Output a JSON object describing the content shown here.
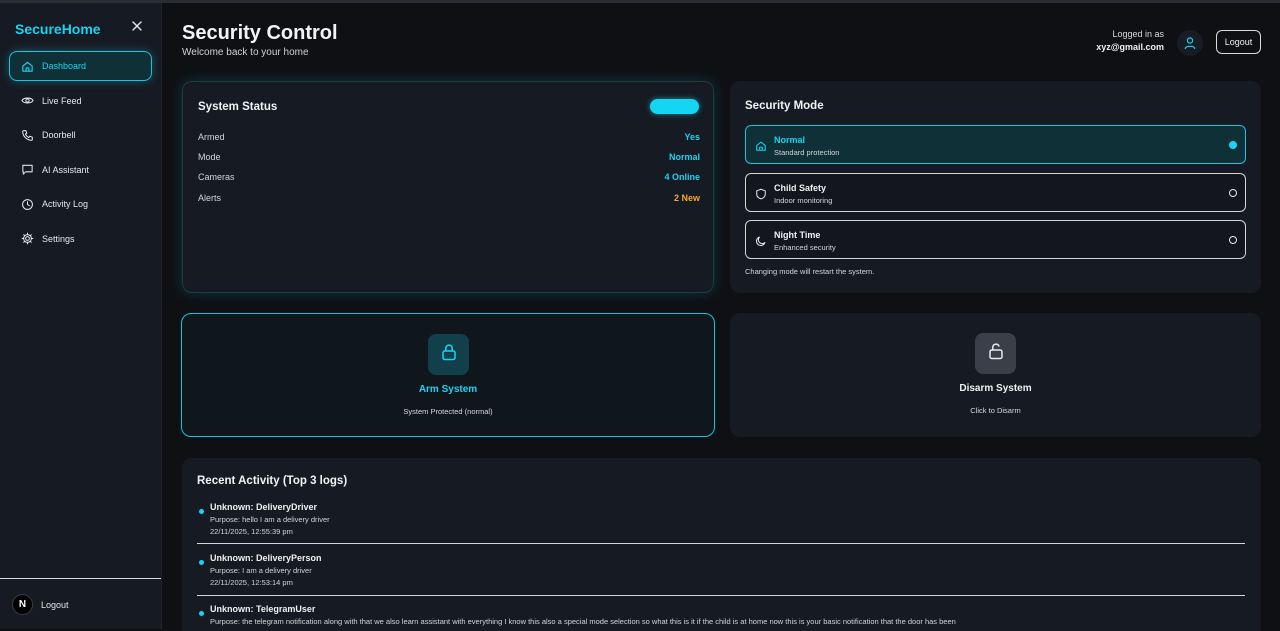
{
  "brand": "SecureHome",
  "sidebar": {
    "items": [
      {
        "label": "Dashboard",
        "icon": "home-icon",
        "active": true
      },
      {
        "label": "Live Feed",
        "icon": "eye-icon"
      },
      {
        "label": "Doorbell",
        "icon": "phone-icon"
      },
      {
        "label": "AI Assistant",
        "icon": "message-icon"
      },
      {
        "label": "Activity Log",
        "icon": "clock-icon"
      },
      {
        "label": "Settings",
        "icon": "gear-icon"
      }
    ],
    "logout_label": "Logout",
    "avatar_letter": "N"
  },
  "header": {
    "title": "Security Control",
    "subtitle": "Welcome back to your home",
    "logged_in_label": "Logged in as",
    "email": "xyz@gmail.com",
    "logout_label": "Logout"
  },
  "status": {
    "title": "System Status",
    "rows": [
      {
        "key": "Armed",
        "value": "Yes",
        "color": "#19d3f3"
      },
      {
        "key": "Mode",
        "value": "Normal",
        "color": "#19d3f3"
      },
      {
        "key": "Cameras",
        "value": "4 Online",
        "color": "#19d3f3"
      },
      {
        "key": "Alerts",
        "value": "2 New",
        "color": "#f5a623"
      }
    ]
  },
  "security_mode": {
    "title": "Security Mode",
    "options": [
      {
        "name": "Normal",
        "desc": "Standard protection",
        "icon": "home-icon",
        "selected": true
      },
      {
        "name": "Child Safety",
        "desc": "Indoor monitoring",
        "icon": "shield-icon",
        "selected": false
      },
      {
        "name": "Night Time",
        "desc": "Enhanced security",
        "icon": "moon-icon",
        "selected": false
      }
    ],
    "note": "Changing mode will restart the system."
  },
  "arm": {
    "title": "Arm System",
    "subtitle": "System Protected (normal)"
  },
  "disarm": {
    "title": "Disarm System",
    "subtitle": "Click to Disarm"
  },
  "activity": {
    "title": "Recent Activity (Top 3 logs)",
    "items": [
      {
        "name": "Unknown: DeliveryDriver",
        "purpose": "Purpose: hello I am a delivery driver",
        "time": "22/11/2025, 12:55:39 pm"
      },
      {
        "name": "Unknown: DeliveryPerson",
        "purpose": "Purpose: I am a delivery driver",
        "time": "22/11/2025, 12:53:14 pm"
      },
      {
        "name": "Unknown: TelegramUser",
        "purpose": "Purpose: the telegram notification along with that we also learn assistant with everything I know this also a special mode selection so what this is it if the child is at home now this is your basic notification that the door has been",
        "time": ""
      }
    ]
  },
  "colors": {
    "accent": "#19d3f3",
    "warning": "#f5a623",
    "background": "#0e1014",
    "card": "#161a22"
  }
}
